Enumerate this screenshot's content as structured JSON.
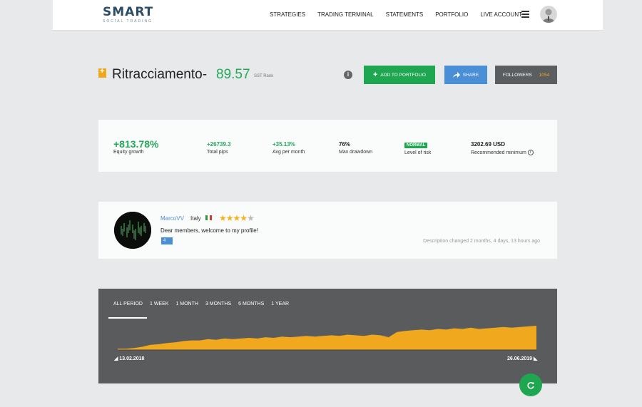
{
  "header": {
    "logo_main": "SMART",
    "logo_sub": "SOCIAL TRADING",
    "menu": [
      {
        "label": "STRATEGIES"
      },
      {
        "label": "TRADING TERMINAL"
      },
      {
        "label": "STATEMENTS"
      },
      {
        "label": "PORTFOLIO"
      },
      {
        "label": "LIVE ACCOUNT"
      }
    ]
  },
  "strategy": {
    "name": "Ritracciamento-",
    "rank": "89.57",
    "rank_label": "SST Rank",
    "buttons": {
      "add": "ADD TO PORTFOLIO",
      "share": "SHARE",
      "followers": "FOLLOWERS",
      "followers_count": "1054"
    }
  },
  "stats": {
    "equity_growth": {
      "value": "+813.78%",
      "label": "Equity growth"
    },
    "total_pips": {
      "value": "+26739.3",
      "label": "Total pips"
    },
    "avg_month": {
      "value": "+35.13%",
      "label": "Avg per month"
    },
    "max_drawdown": {
      "value": "76%",
      "label": "Max drawdown"
    },
    "risk": {
      "value": "NORMAL",
      "label": "Level of risk"
    },
    "min": {
      "value": "3202.69 USD",
      "label": "Recommended minimum"
    }
  },
  "profile": {
    "username": "MarcoVV",
    "country": "Italy",
    "rating": 4,
    "message": "Dear members, welcome to my profile!",
    "tag": "4",
    "changed": "Description changed 2 months, 4 days, 13 hours ago"
  },
  "chart": {
    "tabs": [
      "ALL PERIOD",
      "1 WEEK",
      "1 MONTH",
      "3 MONTHS",
      "6 MONTHS",
      "1 YEAR"
    ],
    "start_date": "13.02.2018",
    "end_date": "26.06.2019"
  },
  "chart_data": {
    "type": "area",
    "x": [
      "13.02.2018",
      "26.06.2019"
    ],
    "values": [
      2,
      2,
      3,
      5,
      8,
      9,
      11,
      12,
      14,
      15,
      15,
      17,
      16,
      18,
      17,
      18,
      19,
      18,
      20,
      19,
      21,
      20,
      21,
      22,
      21,
      22,
      23,
      22,
      24,
      23,
      22,
      24,
      23,
      20,
      28,
      30,
      31,
      32,
      31,
      33,
      32,
      34,
      33,
      35,
      33,
      34,
      35,
      36,
      35,
      36,
      37,
      38
    ]
  },
  "colors": {
    "green": "#1fa651",
    "blue": "#4a8fd6",
    "orange": "#f0a81e",
    "dark": "#595b5d"
  }
}
